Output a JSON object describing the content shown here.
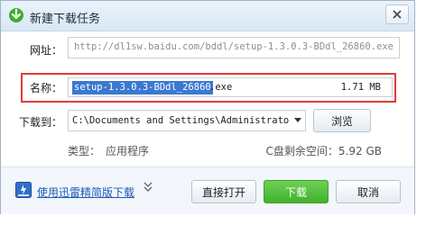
{
  "window": {
    "title": "新建下载任务",
    "close_icon": "close-icon",
    "app_icon": "download-arrow-icon",
    "accent": "#3b79d1"
  },
  "url": {
    "label": "网址：",
    "value": "http://dl1sw.baidu.com/bddl/setup-1.3.0.3-BDdl_26860.exe"
  },
  "name": {
    "label": "名称：",
    "selected_text": "setup-1.3.0.3-BDdl_26860",
    "extension": ".exe",
    "size": "1.71 MB",
    "highlight_color": "#e33a3a"
  },
  "save_to": {
    "label": "下载到：",
    "path": "C:\\Documents and Settings\\Administrator\\...",
    "browse_label": "浏览"
  },
  "info": {
    "type_label": "类型：",
    "type_value": "应用程序",
    "space_text": "C盘剩余空间：5.92 GB"
  },
  "footer": {
    "lite_link": "使用迅雷精简版下载",
    "expand_icon": "double-chevron-down-icon",
    "open_label": "直接打开",
    "download_label": "下载",
    "cancel_label": "取消",
    "download_color": "#41b22e"
  }
}
